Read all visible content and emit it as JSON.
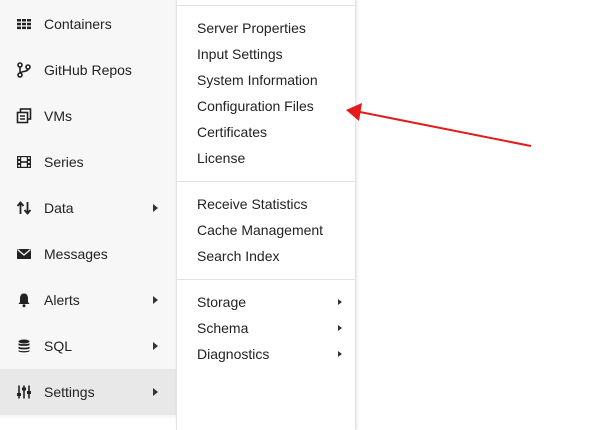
{
  "sidebar": {
    "items": [
      {
        "label": "Containers",
        "icon": "grid-icon"
      },
      {
        "label": "GitHub Repos",
        "icon": "git-branch-icon"
      },
      {
        "label": "VMs",
        "icon": "vm-copy-icon"
      },
      {
        "label": "Series",
        "icon": "film-icon"
      },
      {
        "label": "Data",
        "icon": "sort-arrows-icon",
        "has_submenu": true
      },
      {
        "label": "Messages",
        "icon": "envelope-icon"
      },
      {
        "label": "Alerts",
        "icon": "bell-icon",
        "has_submenu": true
      },
      {
        "label": "SQL",
        "icon": "database-icon",
        "has_submenu": true
      },
      {
        "label": "Settings",
        "icon": "sliders-icon",
        "has_submenu": true,
        "active": true
      }
    ]
  },
  "settings_menu": {
    "groups": [
      [
        "Server Properties",
        "Input Settings",
        "System Information",
        "Configuration Files",
        "Certificates",
        "License"
      ],
      [
        "Receive Statistics",
        "Cache Management",
        "Search Index"
      ],
      [
        "Storage",
        "Schema",
        "Diagnostics"
      ]
    ]
  },
  "annotation": {
    "color": "#e31b1b",
    "points_to": "Configuration Files"
  },
  "colors": {
    "sidebar_bg": "#f7f7f7",
    "active_bg": "#e8e8e8",
    "menu_bg": "#ffffff"
  }
}
